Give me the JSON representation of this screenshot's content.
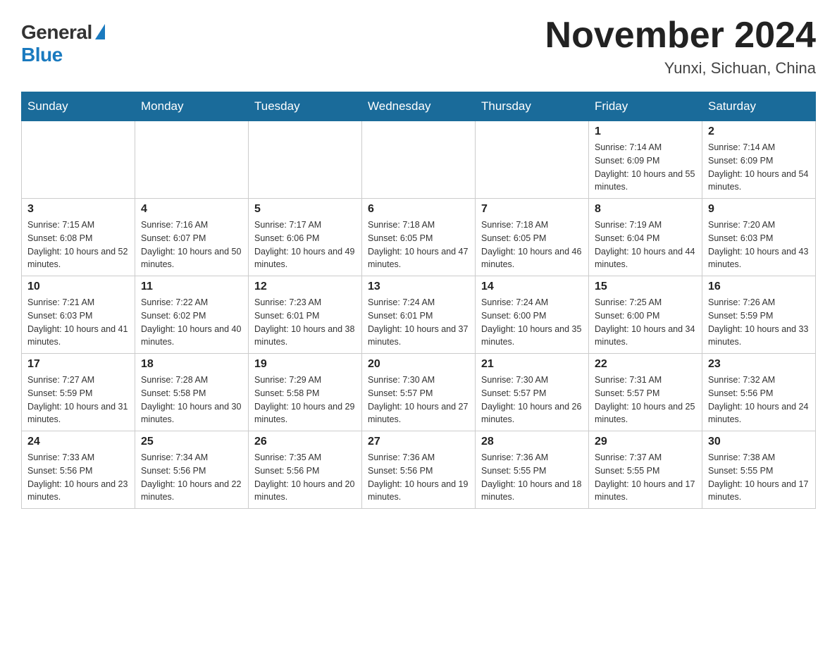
{
  "header": {
    "logo_general": "General",
    "logo_blue": "Blue",
    "title": "November 2024",
    "location": "Yunxi, Sichuan, China"
  },
  "days_of_week": [
    "Sunday",
    "Monday",
    "Tuesday",
    "Wednesday",
    "Thursday",
    "Friday",
    "Saturday"
  ],
  "weeks": [
    [
      {
        "day": "",
        "info": ""
      },
      {
        "day": "",
        "info": ""
      },
      {
        "day": "",
        "info": ""
      },
      {
        "day": "",
        "info": ""
      },
      {
        "day": "",
        "info": ""
      },
      {
        "day": "1",
        "info": "Sunrise: 7:14 AM\nSunset: 6:09 PM\nDaylight: 10 hours and 55 minutes."
      },
      {
        "day": "2",
        "info": "Sunrise: 7:14 AM\nSunset: 6:09 PM\nDaylight: 10 hours and 54 minutes."
      }
    ],
    [
      {
        "day": "3",
        "info": "Sunrise: 7:15 AM\nSunset: 6:08 PM\nDaylight: 10 hours and 52 minutes."
      },
      {
        "day": "4",
        "info": "Sunrise: 7:16 AM\nSunset: 6:07 PM\nDaylight: 10 hours and 50 minutes."
      },
      {
        "day": "5",
        "info": "Sunrise: 7:17 AM\nSunset: 6:06 PM\nDaylight: 10 hours and 49 minutes."
      },
      {
        "day": "6",
        "info": "Sunrise: 7:18 AM\nSunset: 6:05 PM\nDaylight: 10 hours and 47 minutes."
      },
      {
        "day": "7",
        "info": "Sunrise: 7:18 AM\nSunset: 6:05 PM\nDaylight: 10 hours and 46 minutes."
      },
      {
        "day": "8",
        "info": "Sunrise: 7:19 AM\nSunset: 6:04 PM\nDaylight: 10 hours and 44 minutes."
      },
      {
        "day": "9",
        "info": "Sunrise: 7:20 AM\nSunset: 6:03 PM\nDaylight: 10 hours and 43 minutes."
      }
    ],
    [
      {
        "day": "10",
        "info": "Sunrise: 7:21 AM\nSunset: 6:03 PM\nDaylight: 10 hours and 41 minutes."
      },
      {
        "day": "11",
        "info": "Sunrise: 7:22 AM\nSunset: 6:02 PM\nDaylight: 10 hours and 40 minutes."
      },
      {
        "day": "12",
        "info": "Sunrise: 7:23 AM\nSunset: 6:01 PM\nDaylight: 10 hours and 38 minutes."
      },
      {
        "day": "13",
        "info": "Sunrise: 7:24 AM\nSunset: 6:01 PM\nDaylight: 10 hours and 37 minutes."
      },
      {
        "day": "14",
        "info": "Sunrise: 7:24 AM\nSunset: 6:00 PM\nDaylight: 10 hours and 35 minutes."
      },
      {
        "day": "15",
        "info": "Sunrise: 7:25 AM\nSunset: 6:00 PM\nDaylight: 10 hours and 34 minutes."
      },
      {
        "day": "16",
        "info": "Sunrise: 7:26 AM\nSunset: 5:59 PM\nDaylight: 10 hours and 33 minutes."
      }
    ],
    [
      {
        "day": "17",
        "info": "Sunrise: 7:27 AM\nSunset: 5:59 PM\nDaylight: 10 hours and 31 minutes."
      },
      {
        "day": "18",
        "info": "Sunrise: 7:28 AM\nSunset: 5:58 PM\nDaylight: 10 hours and 30 minutes."
      },
      {
        "day": "19",
        "info": "Sunrise: 7:29 AM\nSunset: 5:58 PM\nDaylight: 10 hours and 29 minutes."
      },
      {
        "day": "20",
        "info": "Sunrise: 7:30 AM\nSunset: 5:57 PM\nDaylight: 10 hours and 27 minutes."
      },
      {
        "day": "21",
        "info": "Sunrise: 7:30 AM\nSunset: 5:57 PM\nDaylight: 10 hours and 26 minutes."
      },
      {
        "day": "22",
        "info": "Sunrise: 7:31 AM\nSunset: 5:57 PM\nDaylight: 10 hours and 25 minutes."
      },
      {
        "day": "23",
        "info": "Sunrise: 7:32 AM\nSunset: 5:56 PM\nDaylight: 10 hours and 24 minutes."
      }
    ],
    [
      {
        "day": "24",
        "info": "Sunrise: 7:33 AM\nSunset: 5:56 PM\nDaylight: 10 hours and 23 minutes."
      },
      {
        "day": "25",
        "info": "Sunrise: 7:34 AM\nSunset: 5:56 PM\nDaylight: 10 hours and 22 minutes."
      },
      {
        "day": "26",
        "info": "Sunrise: 7:35 AM\nSunset: 5:56 PM\nDaylight: 10 hours and 20 minutes."
      },
      {
        "day": "27",
        "info": "Sunrise: 7:36 AM\nSunset: 5:56 PM\nDaylight: 10 hours and 19 minutes."
      },
      {
        "day": "28",
        "info": "Sunrise: 7:36 AM\nSunset: 5:55 PM\nDaylight: 10 hours and 18 minutes."
      },
      {
        "day": "29",
        "info": "Sunrise: 7:37 AM\nSunset: 5:55 PM\nDaylight: 10 hours and 17 minutes."
      },
      {
        "day": "30",
        "info": "Sunrise: 7:38 AM\nSunset: 5:55 PM\nDaylight: 10 hours and 17 minutes."
      }
    ]
  ]
}
